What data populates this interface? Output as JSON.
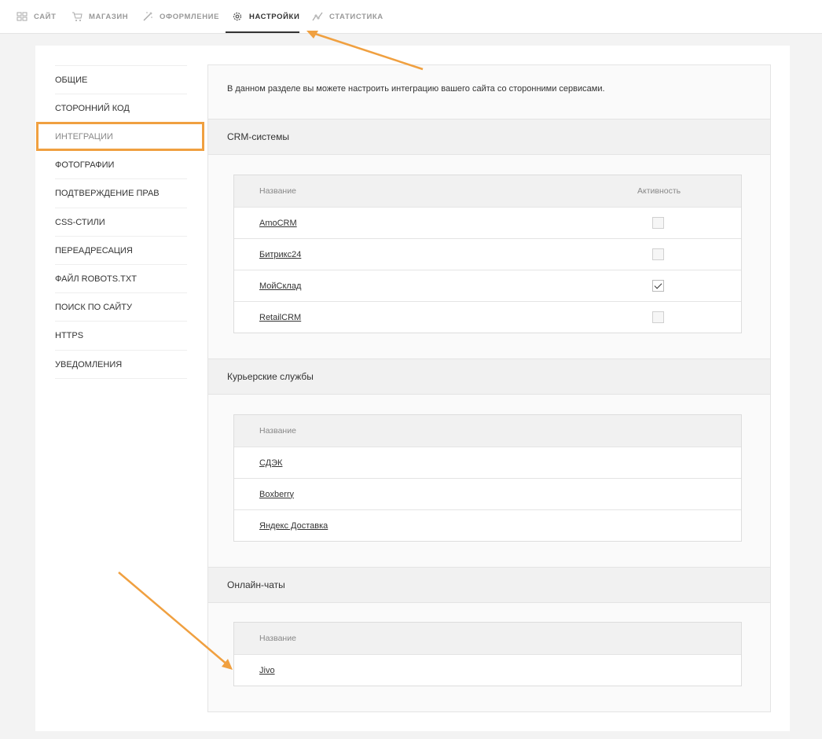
{
  "topnav": {
    "items": [
      {
        "label": "САЙТ",
        "icon": "grid-icon"
      },
      {
        "label": "МАГАЗИН",
        "icon": "cart-icon"
      },
      {
        "label": "ОФОРМЛЕНИЕ",
        "icon": "magic-wand-icon"
      },
      {
        "label": "НАСТРОЙКИ",
        "icon": "gear-icon",
        "active": true
      },
      {
        "label": "СТАТИСТИКА",
        "icon": "chart-line-icon"
      }
    ]
  },
  "sidebar": {
    "items": [
      {
        "label": "ОБЩИЕ"
      },
      {
        "label": "СТОРОННИЙ КОД"
      },
      {
        "label": "ИНТЕГРАЦИИ",
        "active": true
      },
      {
        "label": "ФОТОГРАФИИ"
      },
      {
        "label": "ПОДТВЕРЖДЕНИЕ ПРАВ"
      },
      {
        "label": "CSS-СТИЛИ"
      },
      {
        "label": "ПЕРЕАДРЕСАЦИЯ"
      },
      {
        "label": "ФАЙЛ ROBOTS.TXT"
      },
      {
        "label": "ПОИСК ПО САЙТУ"
      },
      {
        "label": "HTTPS"
      },
      {
        "label": "УВЕДОМЛЕНИЯ"
      }
    ],
    "active_chevron": ">"
  },
  "main": {
    "intro": "В данном разделе вы можете настроить интеграцию вашего сайта со сторонними сервисами.",
    "sections": [
      {
        "title": "CRM-системы",
        "col_name": "Название",
        "col_active": "Активность",
        "rows": [
          {
            "name": "AmoCRM",
            "active": false
          },
          {
            "name": "Битрикс24",
            "active": false
          },
          {
            "name": "МойСклад",
            "active": true
          },
          {
            "name": "RetailCRM",
            "active": false
          }
        ]
      },
      {
        "title": "Курьерские службы",
        "col_name": "Название",
        "rows": [
          {
            "name": "СДЭК"
          },
          {
            "name": "Boxberry"
          },
          {
            "name": "Яндекс Доставка"
          }
        ]
      },
      {
        "title": "Онлайн-чаты",
        "col_name": "Название",
        "rows": [
          {
            "name": "Jivo"
          }
        ]
      }
    ]
  },
  "colors": {
    "annotation": "#f0a040",
    "text": "#333333",
    "muted": "#999999"
  }
}
